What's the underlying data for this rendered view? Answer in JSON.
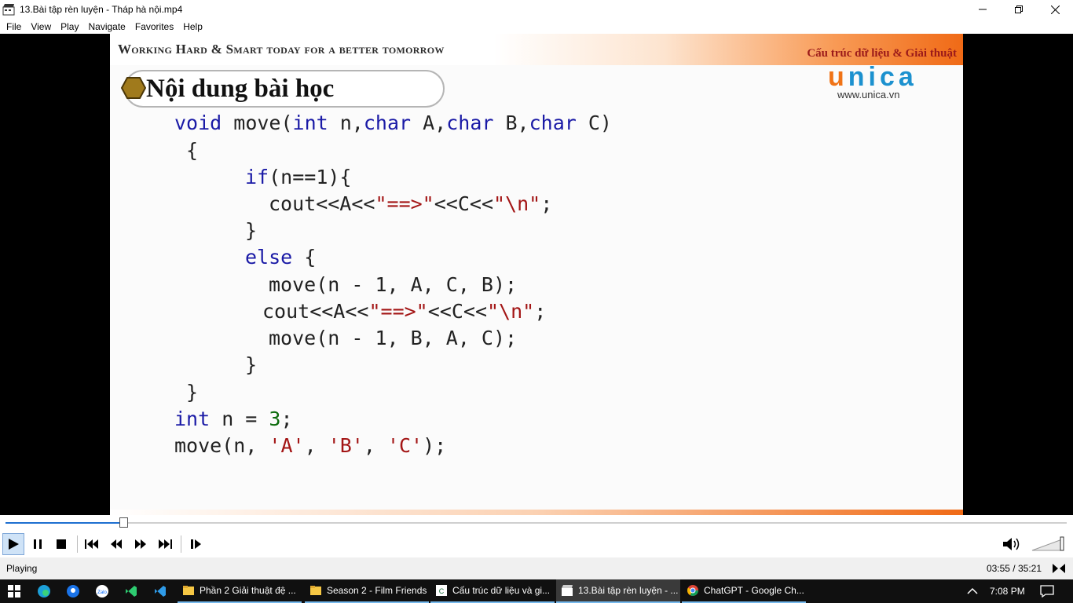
{
  "window": {
    "title": "13.Bài tập rèn luyện - Tháp hà nội.mp4",
    "icon": "film-clapper-icon"
  },
  "menu": [
    "File",
    "View",
    "Play",
    "Navigate",
    "Favorites",
    "Help"
  ],
  "slide": {
    "slogan": "Working Hard & Smart today for a better tomorrow",
    "course": "Cấu trúc dữ liệu & Giải thuật",
    "brand_u": "u",
    "brand_rest": "nica",
    "brand_url": "www.unica.vn",
    "lesson_title": "Nội dung bài học",
    "code": {
      "l1": {
        "kw1": "void",
        "t1": " move(",
        "kw2": "int",
        "t2": " n,",
        "kw3": "char",
        "t3": " A,",
        "kw4": "char",
        "t4": " B,",
        "kw5": "char",
        "t5": " C)"
      },
      "l2": "{",
      "l3": {
        "kw": "if",
        "t": "(n==1){"
      },
      "l4": {
        "t1": "cout<<A<<",
        "s1": "\"==>\"",
        "t2": "<<C<<",
        "s2": "\"\\n\"",
        "t3": ";"
      },
      "l5": "}",
      "l6": {
        "kw": "else",
        "t": " {"
      },
      "l7": "move(n - 1, A, C, B);",
      "l8": {
        "t1": "cout<<A<<",
        "s1": "\"==>\"",
        "t2": "<<C<<",
        "s2": "\"\\n\"",
        "t3": ";"
      },
      "l9": "move(n - 1, B, A, C);",
      "l10": "}",
      "l11": "}",
      "l12": {
        "kw": "int",
        "t1": " n = ",
        "n": "3",
        "t2": ";"
      },
      "l13": {
        "t1": "move(n, ",
        "s1": "'A'",
        "t2": ", ",
        "s2": "'B'",
        "t3": ", ",
        "s3": "'C'",
        "t4": ");"
      }
    }
  },
  "player": {
    "progress": 0.111,
    "status": "Playing",
    "time": "03:55 / 35:21"
  },
  "taskbar": {
    "tasks": [
      {
        "label": "Phần 2 Giải thuật đệ ..."
      },
      {
        "label": "Season 2 - Film Friends"
      },
      {
        "label": "Cấu trúc dữ liệu và gi..."
      },
      {
        "label": "13.Bài tập rèn luyện - ..."
      },
      {
        "label": "ChatGPT - Google Ch..."
      }
    ],
    "clock": "7:08 PM"
  },
  "colors": {
    "accent_orange": "#f07316",
    "brand_blue": "#1c91cf",
    "keyword": "#1a1aa6",
    "string": "#a31515"
  }
}
